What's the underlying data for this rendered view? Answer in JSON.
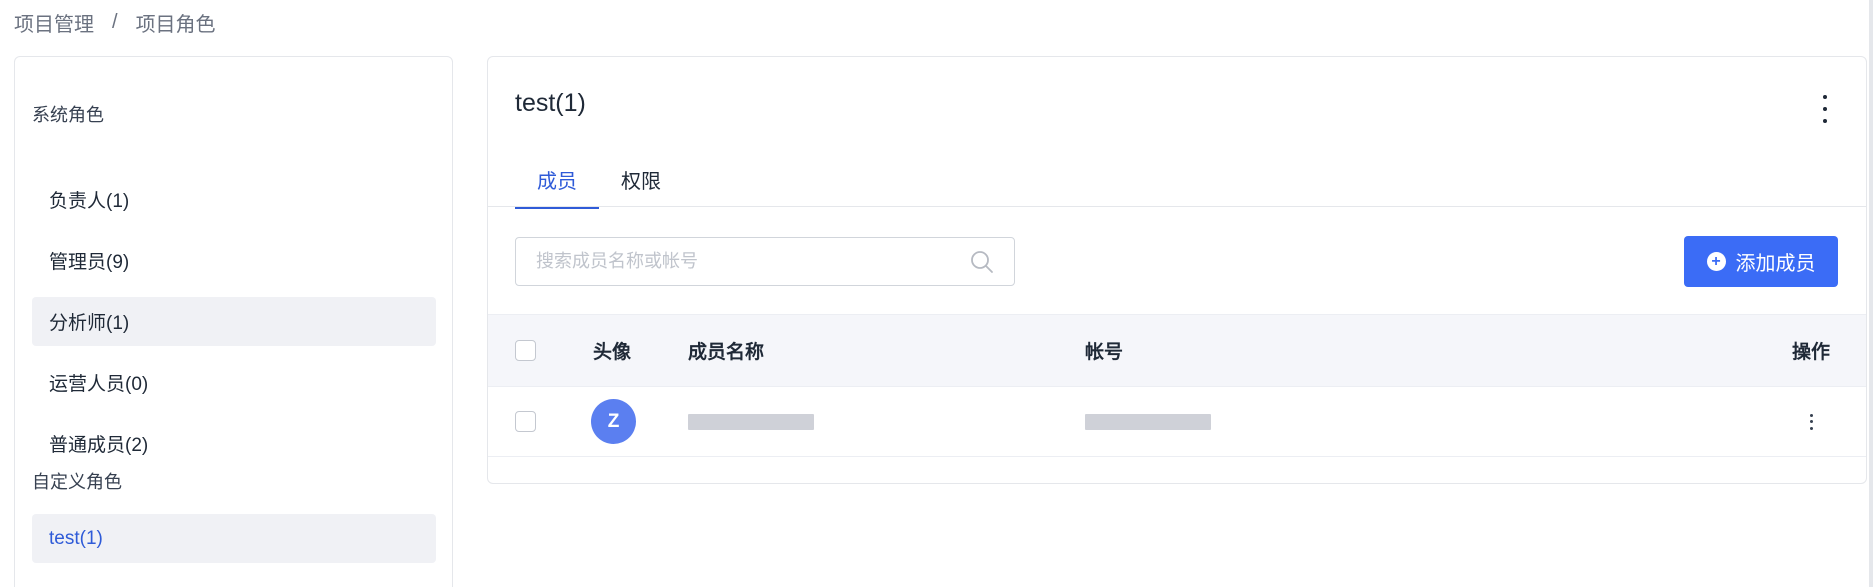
{
  "breadcrumb": {
    "items": [
      "项目管理",
      "项目角色"
    ],
    "separator": "/"
  },
  "sidebar": {
    "system_group_title": "系统角色",
    "system_roles": [
      {
        "label": "负责人(1)"
      },
      {
        "label": "管理员(9)"
      },
      {
        "label": "分析师(1)"
      },
      {
        "label": "运营人员(0)"
      },
      {
        "label": "普通成员(2)"
      }
    ],
    "custom_group_title": "自定义角色",
    "custom_roles": [
      {
        "label": "test(1)",
        "active": true
      }
    ]
  },
  "main": {
    "title": "test(1)",
    "tabs": [
      {
        "label": "成员",
        "active": true
      },
      {
        "label": "权限",
        "active": false
      }
    ],
    "search": {
      "placeholder": "搜索成员名称或帐号",
      "value": ""
    },
    "add_button": {
      "label": "添加成员",
      "icon": "plus-circle-icon"
    },
    "table": {
      "columns": [
        "头像",
        "成员名称",
        "帐号",
        "操作"
      ],
      "rows": [
        {
          "avatar_initial": "Z",
          "name": "",
          "account": ""
        }
      ]
    }
  },
  "colors": {
    "accent": "#3b6cf6",
    "active_text": "#2f5bd8",
    "avatar": "#5b7ff0",
    "hover_bg": "#f0f1f5"
  }
}
